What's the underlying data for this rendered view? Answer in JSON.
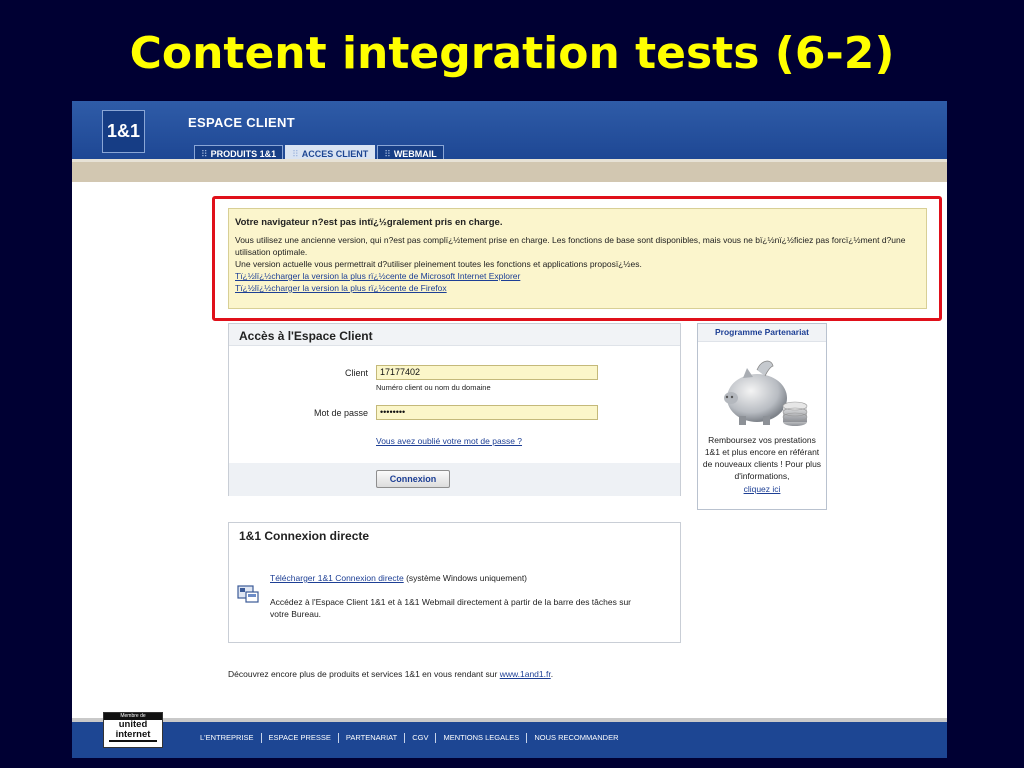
{
  "slide": {
    "title": "Content integration tests (6-2)"
  },
  "header": {
    "logo_text": "1&1",
    "espace_title": "ESPACE CLIENT",
    "tabs": [
      {
        "label": "PRODUITS 1&1"
      },
      {
        "label": "ACCES CLIENT"
      },
      {
        "label": "WEBMAIL"
      }
    ],
    "tab_marker": "⠿"
  },
  "warning": {
    "title": "Votre navigateur n?est pas intï¿½gralement pris en charge.",
    "line1": "Vous utilisez une ancienne version, qui n?est pas complï¿½tement prise en charge. Les fonctions de base sont disponibles, mais vous ne bï¿½nï¿½ficiez pas forcï¿½ment d?une utilisation optimale.",
    "line2": "Une version actuelle vous permettrait d?utiliser pleinement toutes les fonctions et applications proposï¿½es.",
    "link_ie": "Tï¿½lï¿½charger la version la plus rï¿½cente de Microsoft Internet Explorer",
    "link_firefox": "Tï¿½lï¿½charger la version la plus rï¿½cente de Firefox"
  },
  "login": {
    "title": "Accès à l'Espace Client",
    "client_label": "Client",
    "client_value": "17177402",
    "client_hint": "Numéro client ou nom du domaine",
    "password_label": "Mot de passe",
    "password_value": "••••••••",
    "forgot_link": "Vous avez oublié votre mot de passe ?",
    "submit_label": "Connexion"
  },
  "partner": {
    "title": "Programme Partenariat",
    "text": "Remboursez vos prestations 1&1 et plus encore en référant de nouveaux clients ! Pour plus d'informations,",
    "link": "cliquez ici"
  },
  "direct": {
    "title": "1&1 Connexion directe",
    "download_link": "Télécharger 1&1 Connexion directe",
    "download_note": " (système Windows uniquement)",
    "description": "Accédez à l'Espace Client 1&1 et à 1&1 Webmail directement à partir de la barre des tâches sur votre Bureau."
  },
  "discover": {
    "text": "Découvrez encore plus de produits et services 1&1 en vous rendant sur ",
    "link": "www.1and1.fr",
    "suffix": "."
  },
  "footer": {
    "badge_top": "Membre de",
    "badge_word1": "united",
    "badge_word2": "internet",
    "links": [
      "L'ENTREPRISE",
      "ESPACE PRESSE",
      "PARTENARIAT",
      "CGV",
      "MENTIONS LEGALES",
      "NOUS RECOMMANDER"
    ]
  },
  "colors": {
    "slide_bg": "#000033",
    "slide_title": "#ffff00",
    "header_blue": "#1d4693",
    "warning_bg": "#fbf5cc",
    "highlight_red": "#e0101a",
    "link_blue": "#1d3f95"
  }
}
